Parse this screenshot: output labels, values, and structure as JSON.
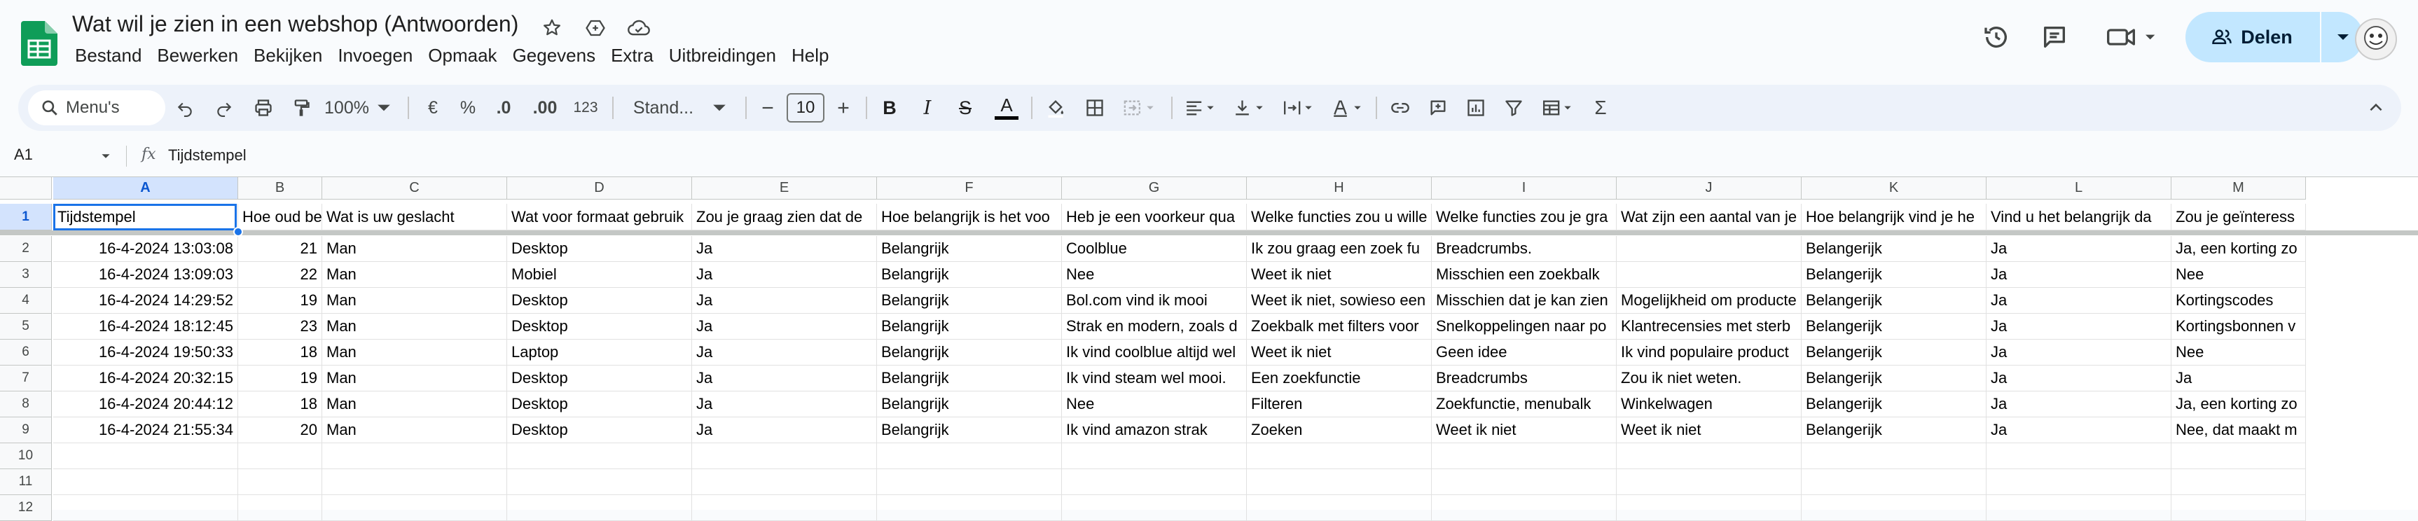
{
  "doc": {
    "title": "Wat wil je zien in een webshop (Antwoorden)",
    "menu": [
      "Bestand",
      "Bewerken",
      "Bekijken",
      "Invoegen",
      "Opmaak",
      "Gegevens",
      "Extra",
      "Uitbreidingen",
      "Help"
    ],
    "share_label": "Delen"
  },
  "toolbar": {
    "search_label": "Menu's",
    "zoom": "100%",
    "currency": "€",
    "percent": "%",
    "dec_less": ".0",
    "dec_more": ".00",
    "number_format": "123",
    "font": "Stand...",
    "font_size": "10",
    "bold": "B",
    "italic": "I",
    "strike": "S",
    "text_color": "A"
  },
  "formula_bar": {
    "cell_ref": "A1",
    "fx": "fx",
    "content": "Tijdstempel"
  },
  "sheet": {
    "columns": [
      "A",
      "B",
      "C",
      "D",
      "E",
      "F",
      "G",
      "H",
      "I",
      "J",
      "K",
      "L",
      "M"
    ],
    "row_numbers": [
      "1",
      "2",
      "3",
      "4",
      "5",
      "6",
      "7",
      "8",
      "9",
      "10",
      "11",
      "12"
    ],
    "header_row": [
      "Tijdstempel",
      "Hoe oud bent u?",
      "Wat is uw geslacht",
      "Wat voor formaat gebruik",
      "Zou je graag zien dat de",
      "Hoe belangrijk is het voo",
      "Heb je een voorkeur qua",
      "Welke functies zou u wille",
      "Welke functies zou je gra",
      "Wat zijn een aantal van je",
      "Hoe belangrijk vind je he",
      "Vind u het belangrijk da",
      "Zou je geïnteress"
    ],
    "rows": [
      [
        "16-4-2024 13:03:08",
        "21",
        "Man",
        "Desktop",
        "Ja",
        "Belangrijk",
        "Coolblue",
        "Ik zou graag een zoek fu",
        "Breadcrumbs.",
        "",
        "Belangerijk",
        "Ja",
        "Ja, een korting zo"
      ],
      [
        "16-4-2024 13:09:03",
        "22",
        "Man",
        "Mobiel",
        "Ja",
        "Belangrijk",
        "Nee",
        "Weet ik niet",
        "Misschien een zoekbalk",
        "",
        "Belangerijk",
        "Ja",
        "Nee"
      ],
      [
        "16-4-2024 14:29:52",
        "19",
        "Man",
        "Desktop",
        "Ja",
        "Belangrijk",
        "Bol.com vind ik mooi",
        "Weet ik niet, sowieso een",
        "Misschien dat je kan zien",
        "Mogelijkheid om producte",
        "Belangerijk",
        "Ja",
        "Kortingscodes"
      ],
      [
        "16-4-2024 18:12:45",
        "23",
        "Man",
        "Desktop",
        "Ja",
        "Belangrijk",
        "Strak en modern, zoals d",
        "Zoekbalk met filters voor",
        "Snelkoppelingen naar po",
        "Klantrecensies met sterb",
        "Belangerijk",
        "Ja",
        "Kortingsbonnen v"
      ],
      [
        "16-4-2024 19:50:33",
        "18",
        "Man",
        "Laptop",
        "Ja",
        "Belangrijk",
        "Ik vind coolblue altijd wel",
        "Weet ik niet",
        "Geen idee",
        "Ik vind populaire product",
        "Belangerijk",
        "Ja",
        "Nee"
      ],
      [
        "16-4-2024 20:32:15",
        "19",
        "Man",
        "Desktop",
        "Ja",
        "Belangrijk",
        "Ik vind steam wel mooi.",
        "Een zoekfunctie",
        "Breadcrumbs",
        "Zou ik niet weten.",
        "Belangerijk",
        "Ja",
        "Ja"
      ],
      [
        "16-4-2024 20:44:12",
        "18",
        "Man",
        "Desktop",
        "Ja",
        "Belangrijk",
        "Nee",
        "Filteren",
        "Zoekfunctie, menubalk",
        "Winkelwagen",
        "Belangerijk",
        "Ja",
        "Ja, een korting zo"
      ],
      [
        "16-4-2024 21:55:34",
        "20",
        "Man",
        "Desktop",
        "Ja",
        "Belangrijk",
        "Ik vind amazon strak",
        "Zoeken",
        "Weet ik niet",
        "Weet ik niet",
        "Belangerijk",
        "Ja",
        "Nee, dat maakt m"
      ]
    ]
  },
  "colors": {
    "accent": "#1a73e8",
    "share_bg": "#c2e7ff",
    "toolbar_bg": "#edf2fa",
    "sheets_green": "#0f9d58"
  },
  "icons": [
    "sheets-logo-icon",
    "star-icon",
    "move-to-drive-icon",
    "cloud-status-icon",
    "history-icon",
    "comments-icon",
    "meet-icon",
    "share-person-icon",
    "search-icon",
    "undo-icon",
    "redo-icon",
    "print-icon",
    "paint-format-icon",
    "borders-icon",
    "merge-icon",
    "align-icon",
    "valign-icon",
    "wrap-icon",
    "rotate-icon",
    "link-icon",
    "comment-add-icon",
    "chart-icon",
    "filter-icon",
    "table-view-icon",
    "functions-icon",
    "chevron-up-icon"
  ]
}
